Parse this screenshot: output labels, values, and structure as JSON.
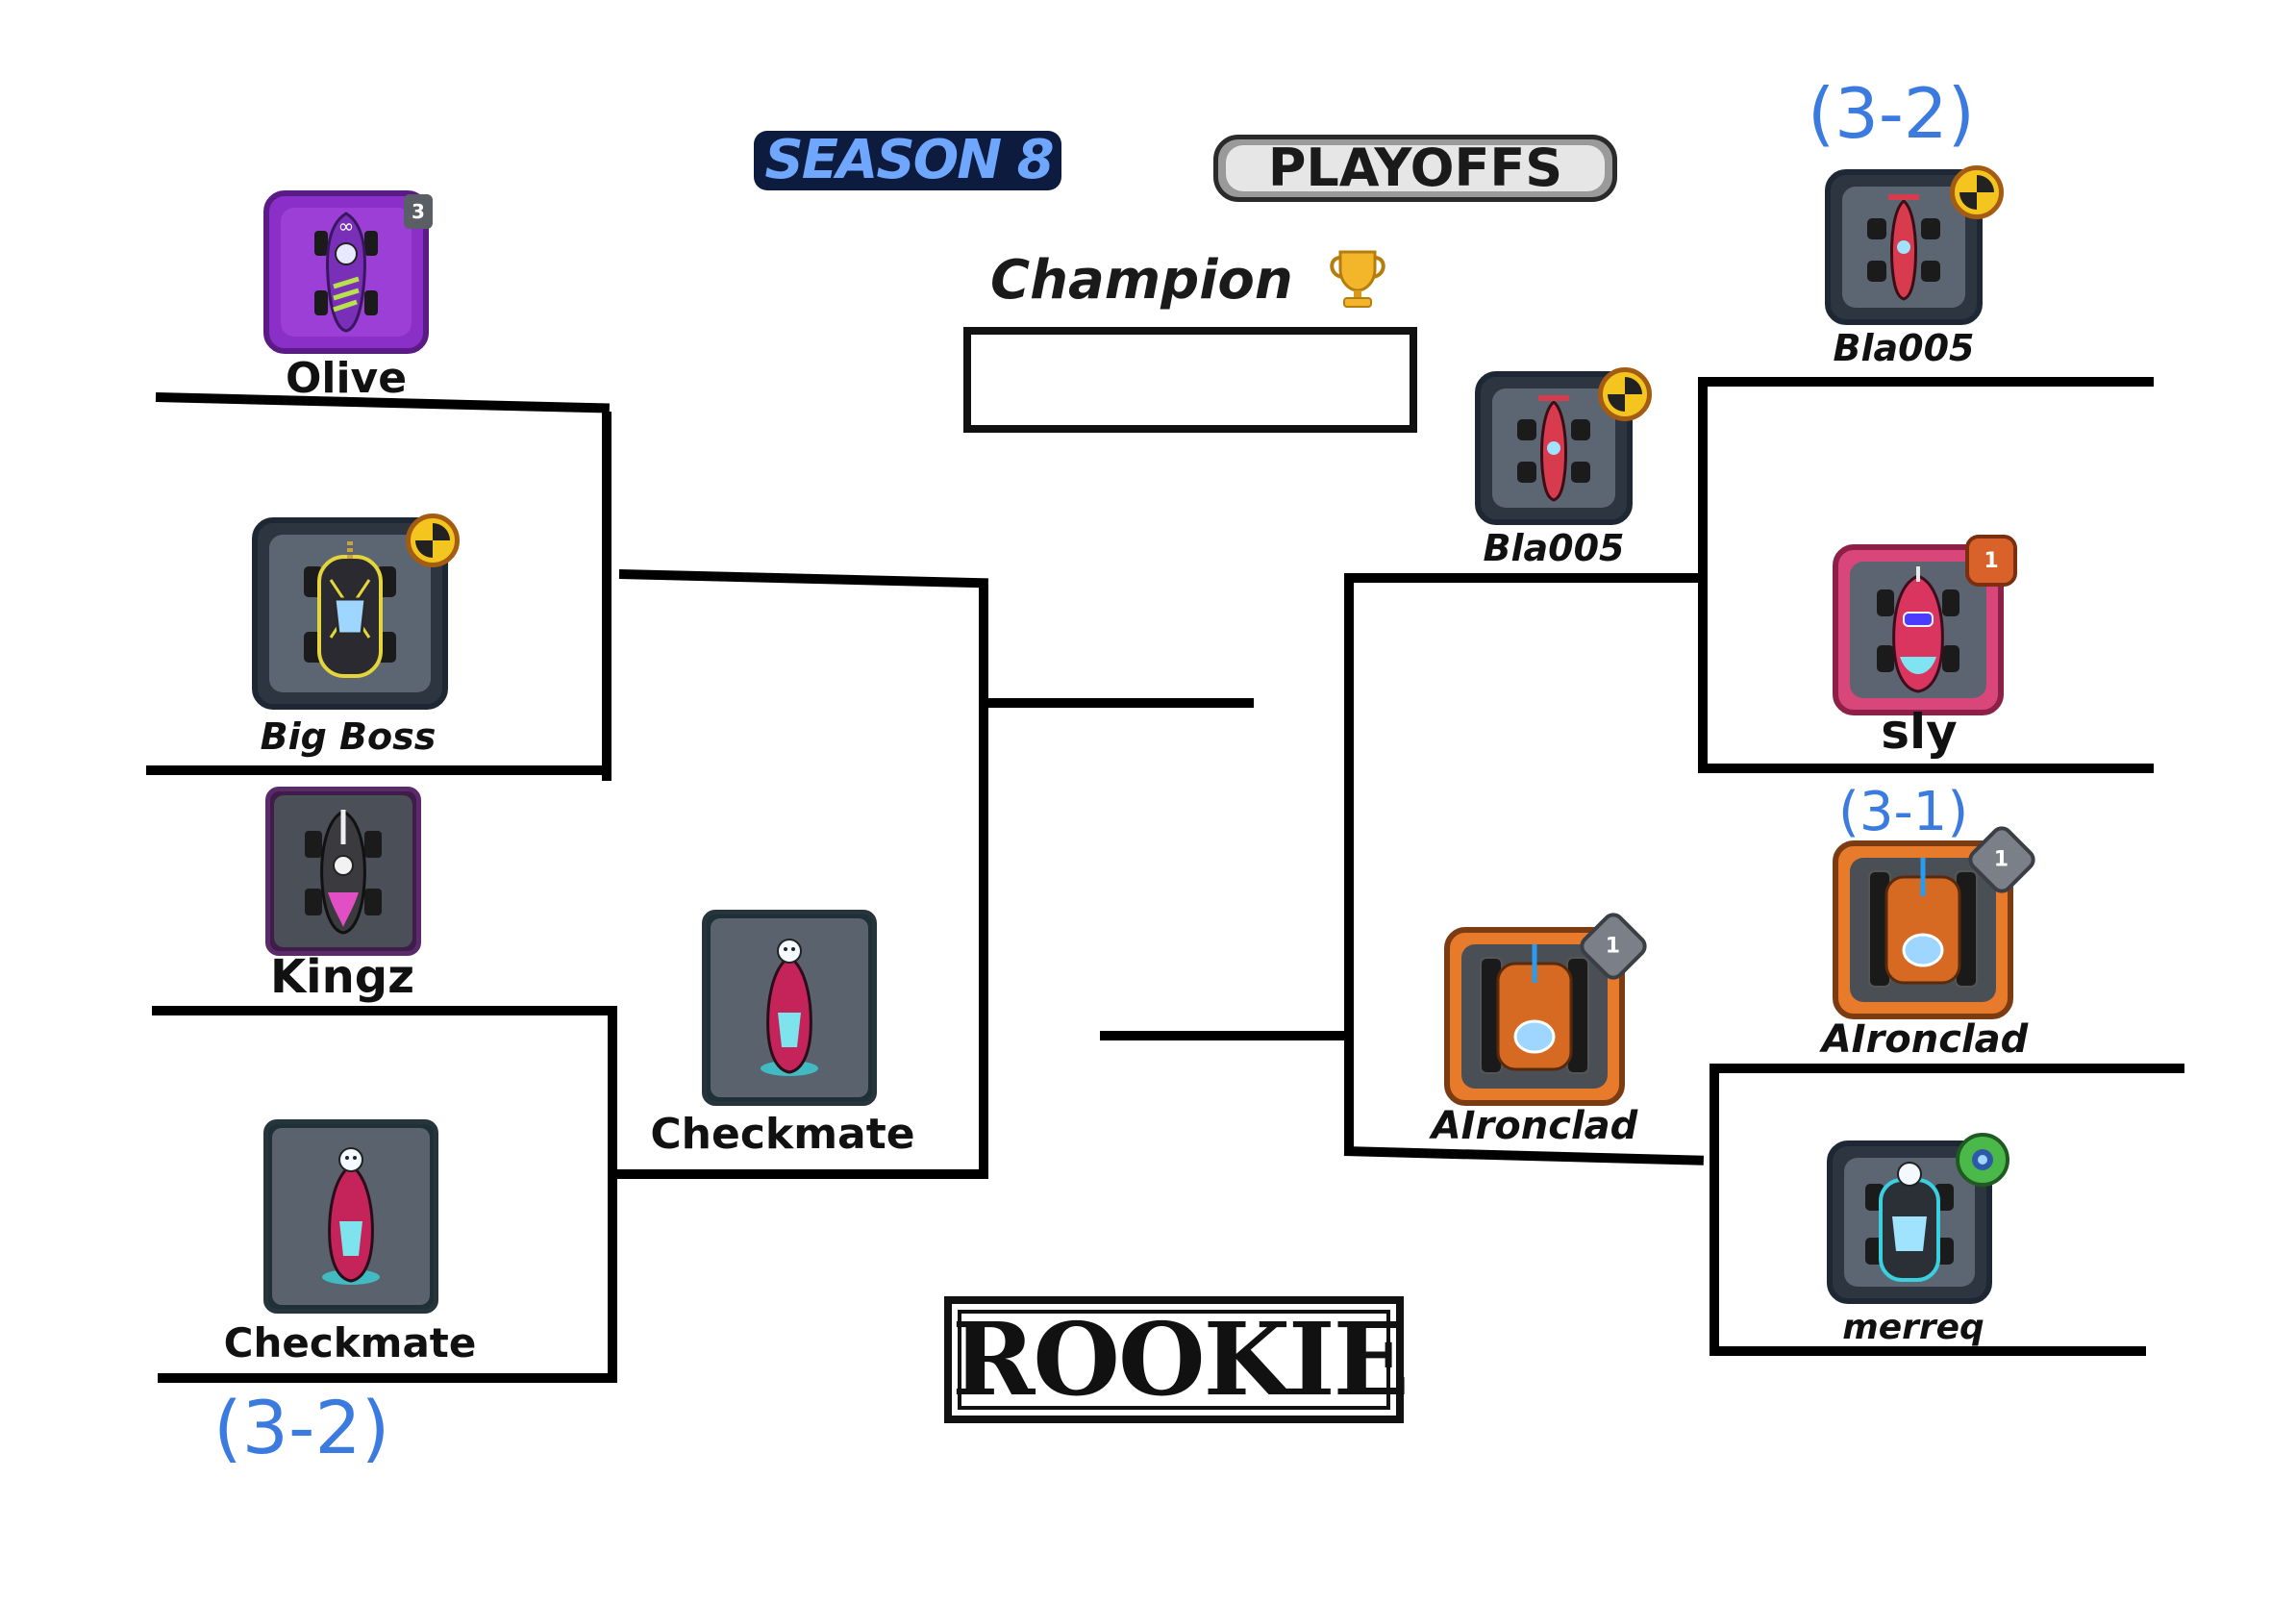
{
  "header": {
    "season": "SEASON 8",
    "playoffs": "PLAYOFFS",
    "champion_label": "Champion",
    "champion_value": "",
    "division": "ROOKIE"
  },
  "left_bracket": {
    "round1": [
      "Olive",
      "Big Boss",
      "Kingz",
      "Checkmate"
    ],
    "round2": [
      "",
      "Checkmate"
    ],
    "final_slot": ""
  },
  "right_bracket": {
    "round1": [
      "Bla005",
      "sly",
      "AIronclad",
      "merreq"
    ],
    "round2": [
      "Bla005",
      "AIronclad"
    ],
    "final_slot": ""
  },
  "scores": {
    "left_checkmate": "(3-2)",
    "right_bla005": "(3-2)",
    "right_aironclad": "(3-1)"
  },
  "badges": {
    "olive": "3",
    "sly": "1",
    "aironclad_r1": "1",
    "aironclad_r2": "1"
  },
  "icons": {
    "trophy": "trophy-icon",
    "league_gold": "crash-test-icon",
    "league_bronze": "hexagon-rank-icon",
    "league_silver": "diamond-rank-icon",
    "league_green": "emerald-rank-icon"
  },
  "colors": {
    "season_text": "#1e4fa8",
    "season_outline": "#0d1c3e",
    "playoffs_bg": "#9a9a9a",
    "score_ink": "#3b7be0",
    "bracket_line": "#000000"
  }
}
